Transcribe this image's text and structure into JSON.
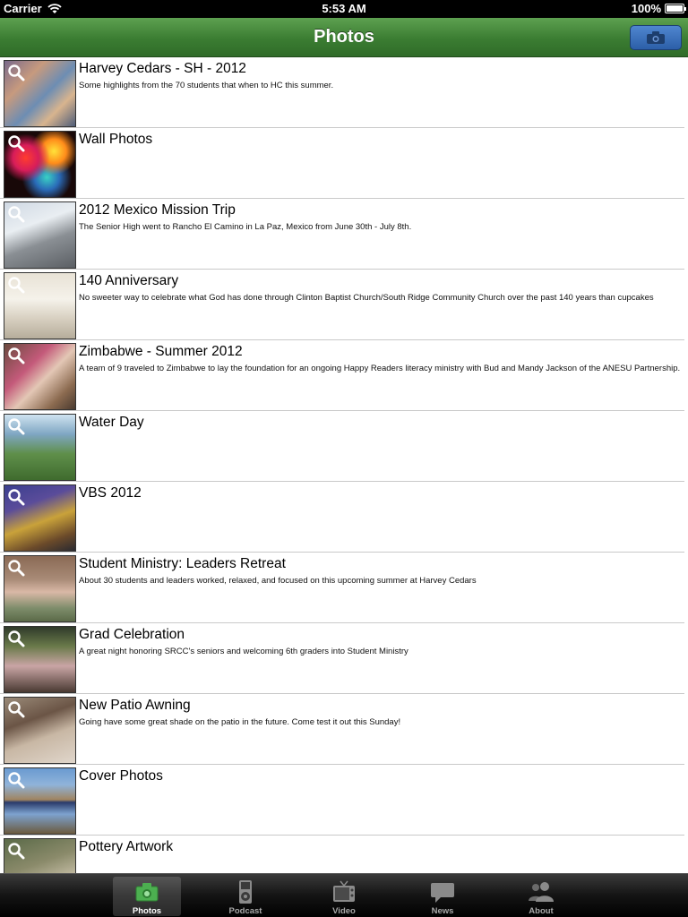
{
  "status_bar": {
    "carrier": "Carrier",
    "time": "5:53 AM",
    "battery": "100%"
  },
  "nav": {
    "title": "Photos",
    "camera_button_icon": "camera-icon"
  },
  "albums": [
    {
      "title": "Harvey Cedars - SH - 2012",
      "description": "Some highlights from the 70 students that when to HC this summer."
    },
    {
      "title": "Wall Photos",
      "description": ""
    },
    {
      "title": "2012 Mexico Mission Trip",
      "description": "The Senior High went to Rancho El Camino in La Paz, Mexico from June 30th - July 8th."
    },
    {
      "title": "140 Anniversary",
      "description": "No sweeter way to celebrate what God has done through Clinton Baptist Church/South Ridge Community Church over the past 140 years than cupcakes"
    },
    {
      "title": "Zimbabwe - Summer 2012",
      "description": "A team of 9 traveled to Zimbabwe to lay the foundation for an ongoing Happy Readers literacy ministry with Bud and Mandy Jackson of the ANESU Partnership."
    },
    {
      "title": "Water Day",
      "description": ""
    },
    {
      "title": "VBS 2012",
      "description": ""
    },
    {
      "title": "Student Ministry: Leaders Retreat",
      "description": "About 30 students and leaders worked, relaxed, and focused on this upcoming summer at Harvey Cedars"
    },
    {
      "title": "Grad Celebration",
      "description": "A great night honoring SRCC's seniors and welcoming 6th graders into Student Ministry"
    },
    {
      "title": "New Patio Awning",
      "description": "Going have some great shade on the patio in the future. Come test it out this Sunday!"
    },
    {
      "title": "Cover Photos",
      "description": ""
    },
    {
      "title": "Pottery Artwork",
      "description": ""
    }
  ],
  "tabs": [
    {
      "label": "Photos",
      "icon": "camera-icon",
      "active": true
    },
    {
      "label": "Podcast",
      "icon": "ipod-icon",
      "active": false
    },
    {
      "label": "Video",
      "icon": "tv-icon",
      "active": false
    },
    {
      "label": "News",
      "icon": "speech-bubble-icon",
      "active": false
    },
    {
      "label": "About",
      "icon": "people-icon",
      "active": false
    }
  ],
  "colors": {
    "nav_green": "#3b7d32",
    "nav_button_blue": "#2c5fa8",
    "tab_active_icon": "#4caf50"
  }
}
